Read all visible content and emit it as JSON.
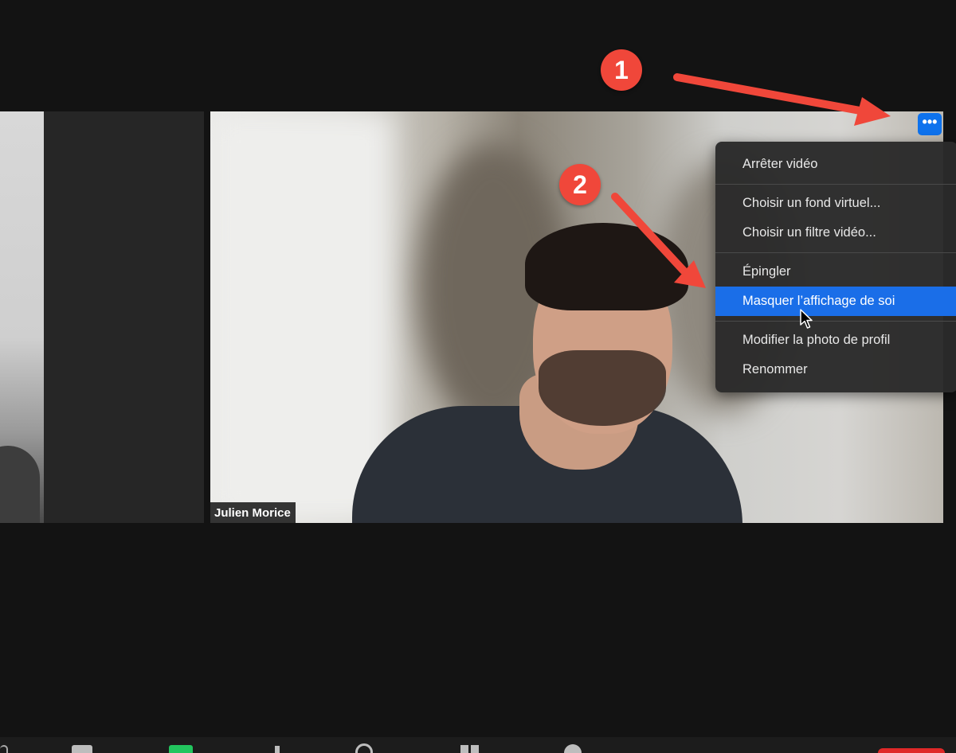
{
  "annotations": {
    "badge_1": "1",
    "badge_2": "2",
    "accent_color": "#f0473a"
  },
  "participant": {
    "name": "Julien Morice"
  },
  "more_button": {
    "icon": "more-dots-icon",
    "label": "•••",
    "color": "#0e72ed"
  },
  "context_menu": {
    "items": [
      {
        "label": "Arrêter vidéo"
      },
      {
        "label": "Choisir un fond virtuel..."
      },
      {
        "label": "Choisir un filtre vidéo..."
      },
      {
        "label": "Épingler"
      },
      {
        "label": "Masquer l’affichage de soi",
        "highlighted": true
      },
      {
        "label": "Modifier la photo de profil"
      },
      {
        "label": "Renommer"
      }
    ],
    "highlight_color": "#1a6ee8"
  },
  "toolbar": {
    "icons": [
      "audio-icon",
      "video-icon",
      "security-icon",
      "participants-icon",
      "record-icon",
      "apps-icon",
      "reactions-icon",
      "end-button"
    ]
  }
}
